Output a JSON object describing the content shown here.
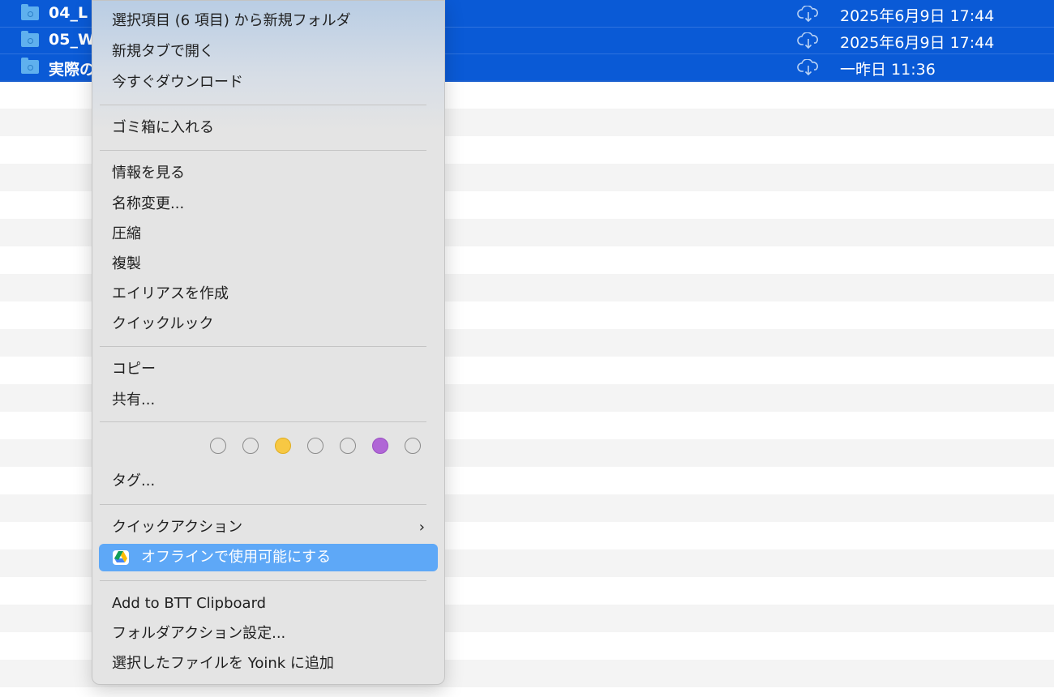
{
  "finder": {
    "selected_rows": [
      {
        "name": "04_L",
        "date": "2025年6月9日 17:44"
      },
      {
        "name": "05_W",
        "date": "2025年6月9日 17:44"
      },
      {
        "name": "実際の",
        "date": "一昨日 11:36"
      }
    ]
  },
  "context_menu": {
    "group1": {
      "new_folder_from_selection": "選択項目 (6 項目) から新規フォルダ",
      "open_in_new_tab": "新規タブで開く",
      "download_now": "今すぐダウンロード"
    },
    "group2": {
      "move_to_trash": "ゴミ箱に入れる"
    },
    "group3": {
      "get_info": "情報を見る",
      "rename": "名称変更...",
      "compress": "圧縮",
      "duplicate": "複製",
      "make_alias": "エイリアスを作成",
      "quick_look": "クイックルック"
    },
    "group4": {
      "copy": "コピー",
      "share": "共有..."
    },
    "tags": {
      "colors": [
        "none",
        "none",
        "#f7c843",
        "none",
        "none",
        "#b066d6",
        "none"
      ],
      "tags_label": "タグ..."
    },
    "group5": {
      "quick_actions": "クイックアクション",
      "quick_actions_chevron": "›",
      "make_available_offline": "オフラインで使用可能にする"
    },
    "group6": {
      "add_to_btt": "Add to BTT Clipboard",
      "folder_actions": "フォルダアクション設定...",
      "add_to_yoink": "選択したファイルを Yoink に追加"
    }
  }
}
